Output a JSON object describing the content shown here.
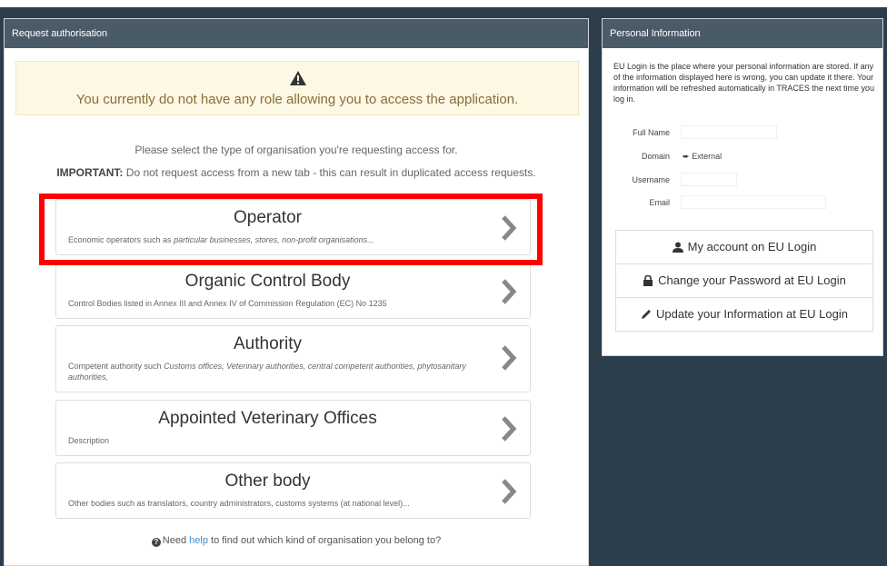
{
  "left_panel": {
    "title": "Request authorisation",
    "warning": {
      "icon": "warning-icon",
      "text": "You currently do not have any role allowing you to access the application."
    },
    "instruction": "Please select the type of organisation you're requesting access for.",
    "important_label": "IMPORTANT:",
    "important_text": " Do not request access from a new tab - this can result in duplicated access requests.",
    "organisations": [
      {
        "title": "Operator",
        "desc_plain": "Economic operators such as ",
        "desc_em": "particular businesses, stores, non-profit organisations...",
        "desc_tail": ""
      },
      {
        "title": "Organic Control Body",
        "desc_plain": "Control Bodies listed in Annex III and Annex IV of Commission Regulation (EC) No 1235",
        "desc_em": "",
        "desc_tail": ""
      },
      {
        "title": "Authority",
        "desc_plain": "Competent authority such ",
        "desc_em": "Customs offices, Veterinary authorities, central competent authorities, phytosanitary authorities,",
        "desc_tail": ""
      },
      {
        "title": "Appointed Veterinary Offices",
        "desc_plain": "Description",
        "desc_em": "",
        "desc_tail": ""
      },
      {
        "title": "Other body",
        "desc_plain": "Other bodies such as translators, country administrators, customs systems (at national level)...",
        "desc_em": "",
        "desc_tail": ""
      }
    ],
    "help": {
      "prefix": "Need ",
      "link": "help",
      "suffix": " to find out which kind of organisation you belong to?"
    }
  },
  "right_panel": {
    "title": "Personal Information",
    "info": "EU Login is the place where your personal information are stored. If any of the information displayed here is wrong, you can update it there. Your information will be refreshed automatically in TRACES the next time you log in.",
    "fields": {
      "full_name_label": "Full Name",
      "domain_label": "Domain",
      "domain_value": "External",
      "username_label": "Username",
      "email_label": "Email"
    },
    "buttons": {
      "my_account": "My account on EU Login",
      "change_password": "Change your Password at EU Login",
      "update_info": "Update your Information at EU Login"
    }
  },
  "colors": {
    "panel_header": "#4a5b68",
    "background": "#2c3e4c",
    "warning_bg": "#fcf8e3",
    "warning_text": "#8a6d3b",
    "highlight": "#ff0000",
    "link": "#3a8fd2"
  }
}
